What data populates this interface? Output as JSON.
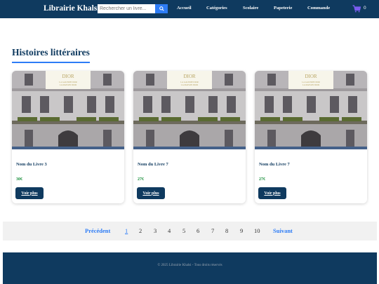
{
  "navbar": {
    "brand": "Librairie Khalsi",
    "search_placeholder": "Rechercher un livre...",
    "links": [
      "Accueil",
      "Catégories",
      "Scolaire",
      "Papeterie",
      "Commande"
    ],
    "cart_count": "0"
  },
  "section": {
    "title": "Histoires littéraires"
  },
  "cards": [
    {
      "title": "Nom du Livre 3",
      "price": "30€",
      "button": "Voir plus",
      "image_text": [
        "DIOR",
        "LA GALERIE DIOR",
        "LA MAISON DIOR"
      ]
    },
    {
      "title": "Nom du Livre 7",
      "price": "27€",
      "button": "Voir plus",
      "image_text": [
        "DIOR",
        "LA GALERIE DIOR",
        "LA MAISON DIOR"
      ]
    },
    {
      "title": "Nom du Livre 7",
      "price": "27€",
      "button": "Voir plus",
      "image_text": [
        "DIOR",
        "LA GALERIE DIOR",
        "LA MAISON DIOR"
      ]
    }
  ],
  "pagination": {
    "prev": "Précédent",
    "pages": [
      "1",
      "2",
      "3",
      "4",
      "5",
      "6",
      "7",
      "8",
      "9",
      "10"
    ],
    "active_page": "1",
    "next": "Suivant"
  },
  "footer": {
    "text": "© 2025 Librairie Khalsi - Tous droits réservés"
  },
  "colors": {
    "navbar": "#0f3a5f",
    "accent": "#2d7cf6",
    "price": "#1a8f3c",
    "footer": "#0f3a5f"
  }
}
